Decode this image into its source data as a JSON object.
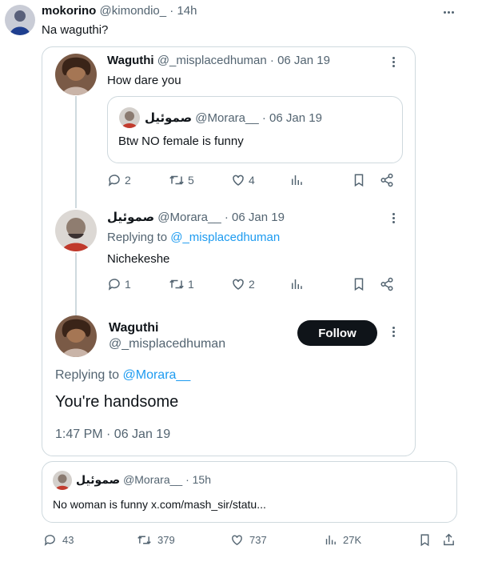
{
  "post": {
    "author_name": "mokorino",
    "author_handle": "@kimondio_",
    "time": "· 14h",
    "text": "Na waguthi?",
    "stats": {
      "replies": "43",
      "reposts": "379",
      "likes": "737",
      "views": "27K"
    }
  },
  "thread": {
    "tweet1": {
      "name": "Waguthi",
      "handle": "@_misplacedhuman",
      "date": "· 06 Jan 19",
      "text": "How dare you",
      "quoted": {
        "name": "صموئيل",
        "handle": "@Morara__",
        "date": "· 06 Jan 19",
        "text": "Btw NO female is funny"
      },
      "stats": {
        "replies": "2",
        "reposts": "5",
        "likes": "4"
      }
    },
    "tweet2": {
      "name": "صموئيل",
      "handle": "@Morara__",
      "date": "· 06 Jan 19",
      "replying_prefix": "Replying to",
      "replying_to": "@_misplacedhuman",
      "text": "Nichekeshe",
      "stats": {
        "replies": "1",
        "reposts": "1",
        "likes": "2"
      }
    },
    "tweet3": {
      "name": "Waguthi",
      "handle": "@_misplacedhuman",
      "follow_label": "Follow",
      "replying_prefix": "Replying to",
      "replying_to": "@Morara__",
      "text": "You're handsome",
      "timestamp": "1:47 PM · 06 Jan 19"
    }
  },
  "quote_card": {
    "name": "صموئيل",
    "handle": "@Morara__",
    "time": "· 15h",
    "text": "No woman is funny x.com/mash_sir/statu..."
  },
  "colors": {
    "link_blue": "#1d9bf0",
    "grey_text": "#536471",
    "border": "#cfd9de",
    "button_black": "#0f1419"
  },
  "icons": [
    "ellipsis-icon",
    "reply-icon",
    "repost-icon",
    "like-icon",
    "views-icon",
    "bookmark-icon",
    "share-icon"
  ]
}
